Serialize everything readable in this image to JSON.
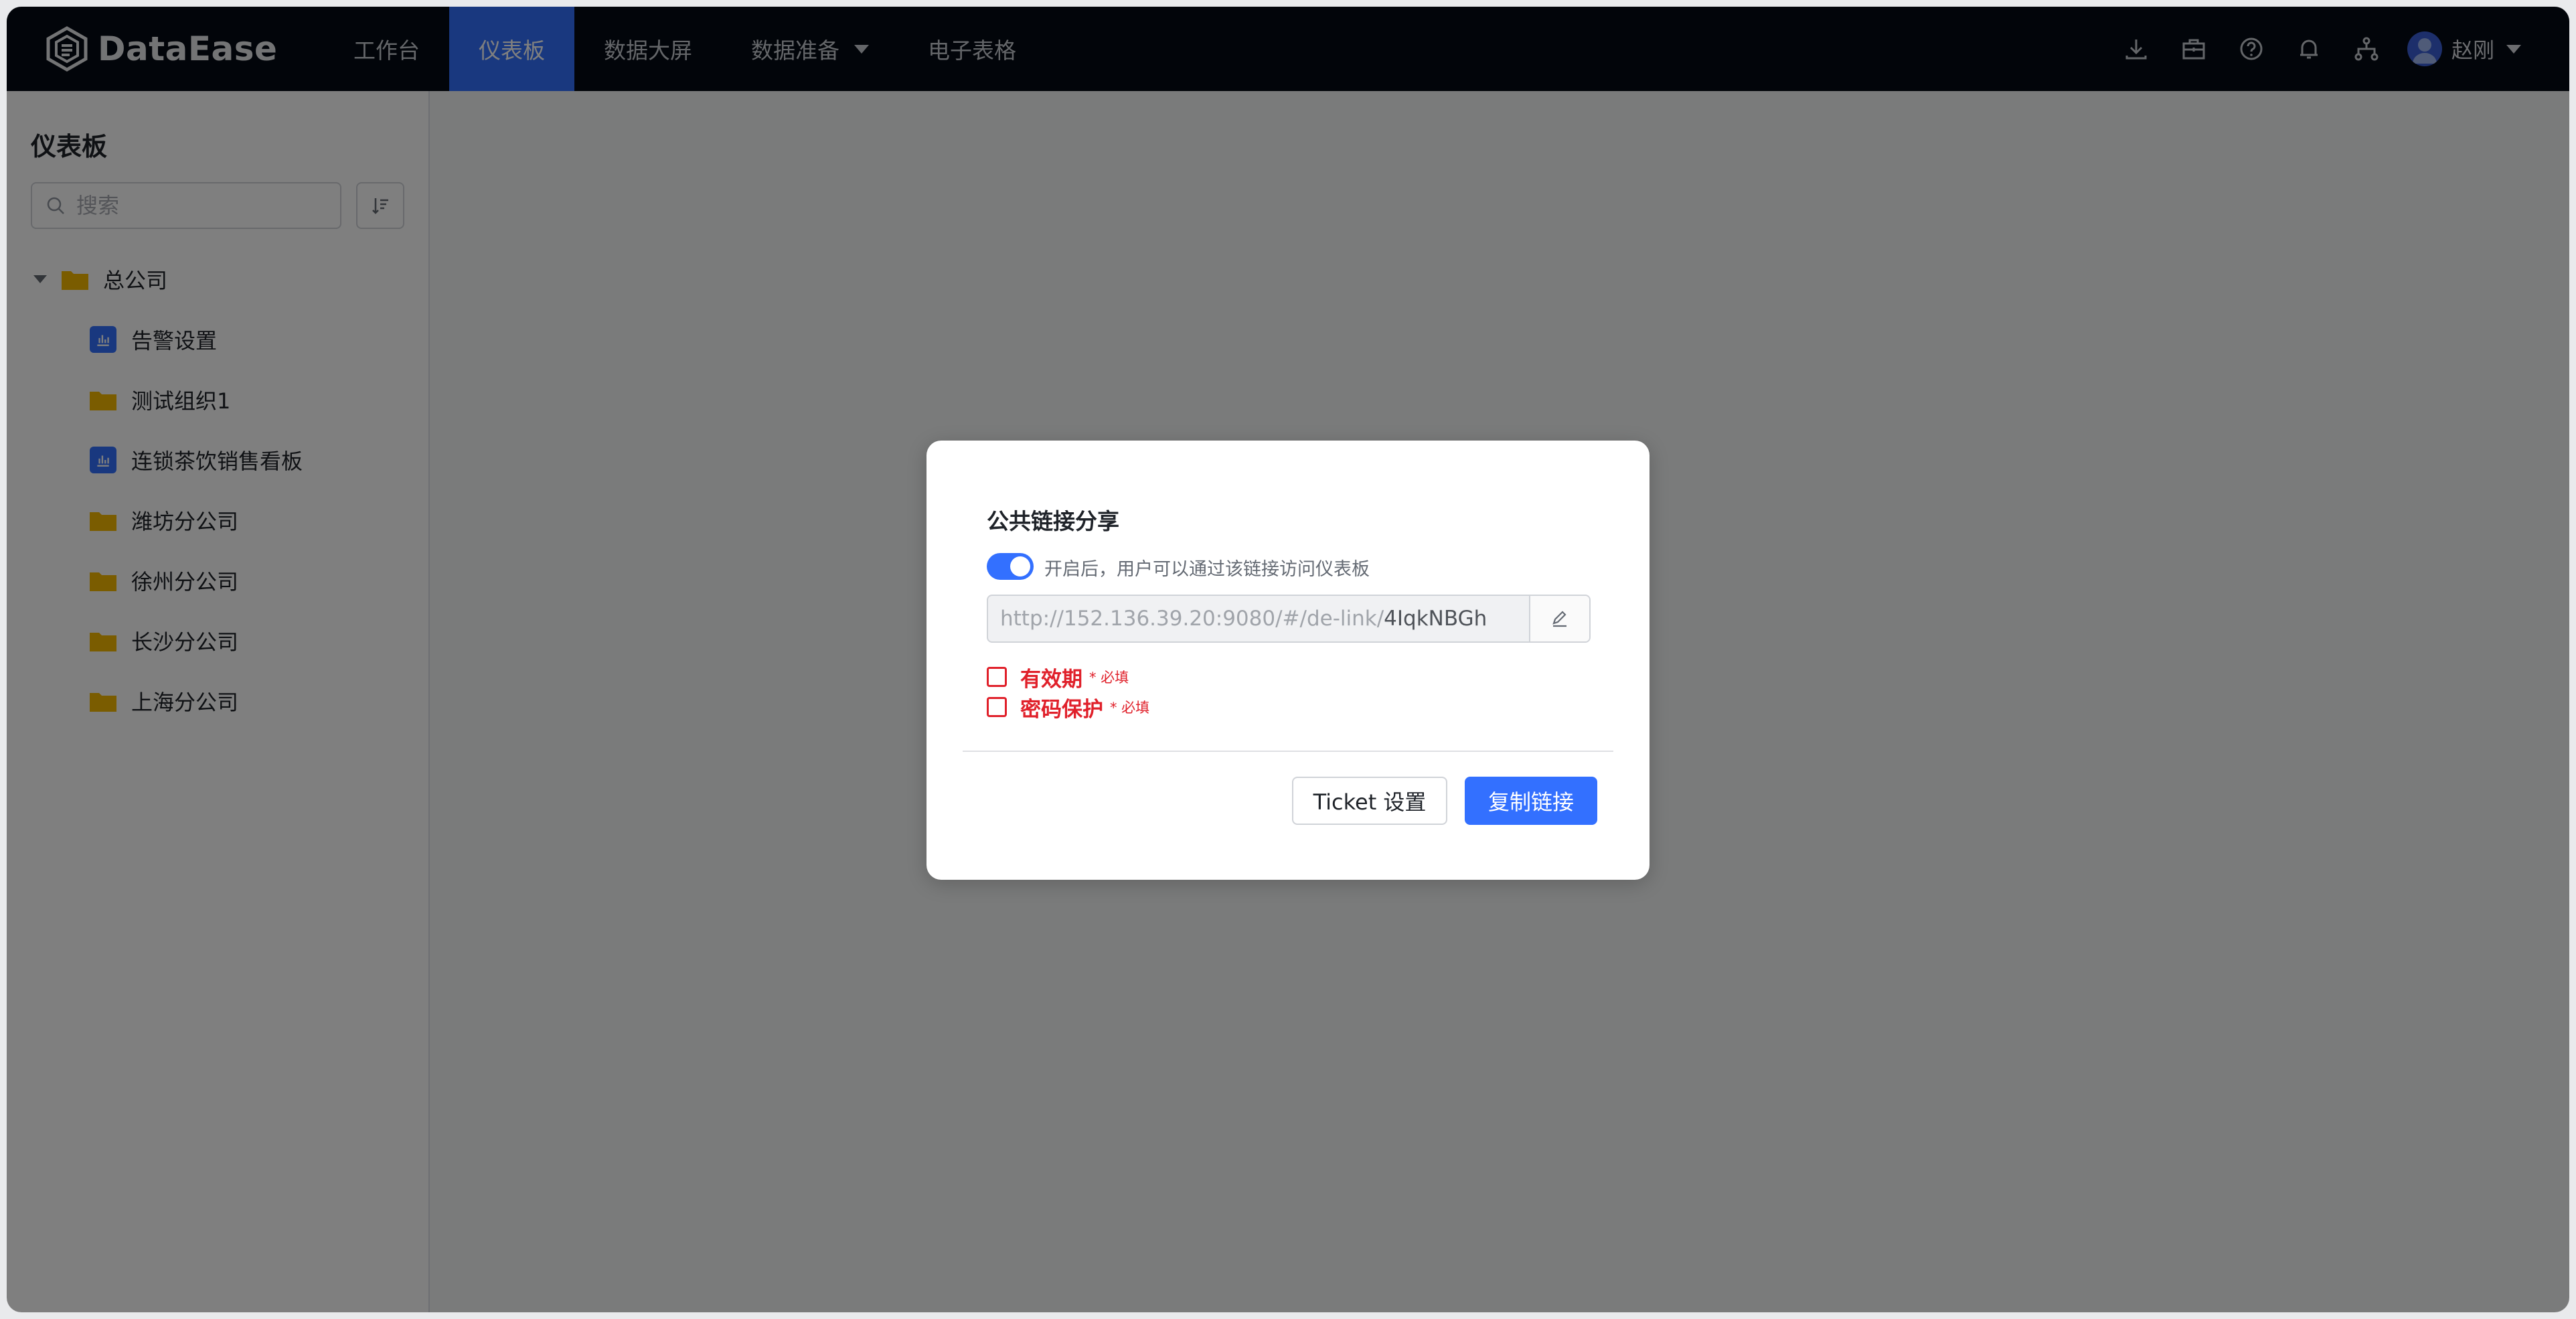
{
  "brand": {
    "name": "DataEase"
  },
  "nav": {
    "items": [
      {
        "label": "工作台"
      },
      {
        "label": "仪表板"
      },
      {
        "label": "数据大屏"
      },
      {
        "label": "数据准备"
      },
      {
        "label": "电子表格"
      }
    ],
    "icons": [
      "download-icon",
      "toolbox-icon",
      "help-icon",
      "bell-icon",
      "org-icon"
    ],
    "user": {
      "name": "赵刚"
    }
  },
  "sidebar": {
    "title": "仪表板",
    "search_placeholder": "搜索",
    "tree": {
      "root": "总公司",
      "children": [
        {
          "label": "告警设置",
          "type": "dashboard"
        },
        {
          "label": "测试组织1",
          "type": "folder"
        },
        {
          "label": "连锁茶饮销售看板",
          "type": "dashboard"
        },
        {
          "label": "潍坊分公司",
          "type": "folder"
        },
        {
          "label": "徐州分公司",
          "type": "folder"
        },
        {
          "label": "长沙分公司",
          "type": "folder"
        },
        {
          "label": "上海分公司",
          "type": "folder"
        }
      ]
    }
  },
  "dialog": {
    "title": "公共链接分享",
    "toggle_on": true,
    "toggle_hint": "开启后，用户可以通过该链接访问仪表板",
    "link_prefix": "http://152.136.39.20:9080/#/de-link/",
    "link_token": "4IqkNBGh",
    "expiry_label": "有效期",
    "password_label": "密码保护",
    "required_mark": "* 必填",
    "ticket_button": "Ticket 设置",
    "copy_button": "复制链接"
  },
  "colors": {
    "nav_bg": "#050a14",
    "accent": "#3370ff",
    "folder": "#f5b800",
    "error": "#e0202a"
  }
}
